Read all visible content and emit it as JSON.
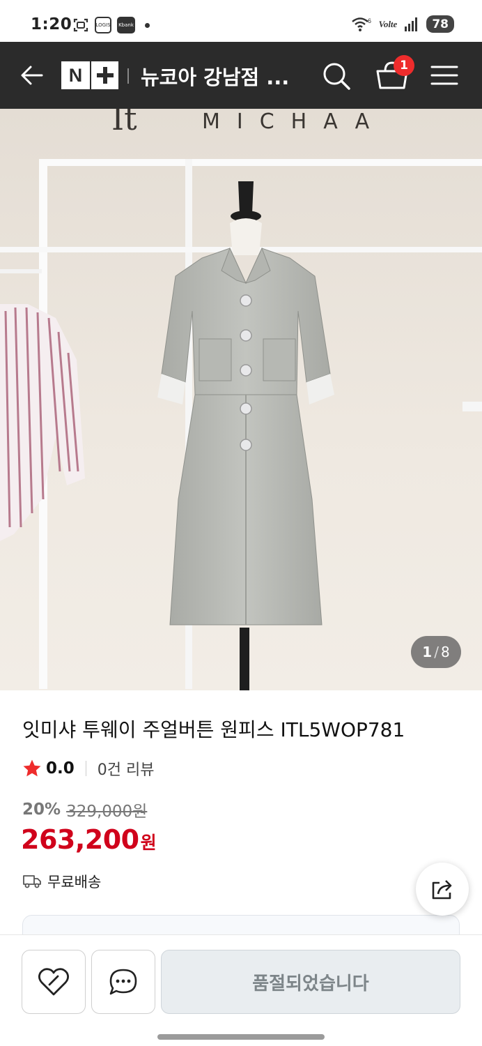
{
  "status_bar": {
    "time": "1:20",
    "icons": [
      "screenshot-icon",
      "logis-icon",
      "kbank-icon",
      "notification-dot"
    ],
    "mini_label_1": "LOGIS",
    "mini_label_2": "Kbank",
    "network": "6",
    "volte": "Volte",
    "battery": "78"
  },
  "header": {
    "title": "뉴코아 강남점 ...",
    "logo_letter": "N",
    "cart_count": "1",
    "background": "#2b2b2b",
    "badge_color": "#ee2c2c"
  },
  "gallery": {
    "current": "1",
    "separator": "/",
    "total": "8"
  },
  "product": {
    "name": "잇미샤 투웨이 주얼버튼 원피스 ITL5WOP781",
    "rating": "0.0",
    "review_count": "0건 리뷰",
    "discount_rate": "20%",
    "original_price": "329,000원",
    "sale_price": "263,200",
    "currency": "원",
    "shipping": "무료배송",
    "price_color": "#d0021b"
  },
  "bottom_bar": {
    "soldout_label": "품절되었습니다"
  }
}
